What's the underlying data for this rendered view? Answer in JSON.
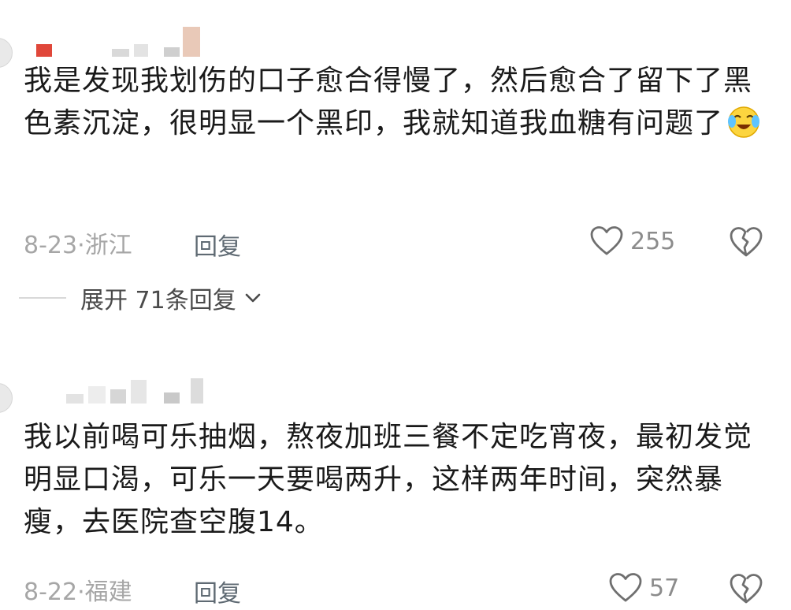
{
  "comments": [
    {
      "text": "我是发现我划伤的口子愈合得慢了，然后愈合了留下了黑色素沉淀，很明显一个黑印，我就知道我血糖有问题了",
      "emoji": "crying-laughing-emoji",
      "date": "8-23·浙江",
      "reply_label": "回复",
      "likes": "255"
    },
    {
      "text": "我以前喝可乐抽烟，熬夜加班三餐不定吃宵夜，最初发觉明显口渴，可乐一天要喝两升，这样两年时间，突然暴瘦，去医院查空腹14。",
      "date": "8-22·福建",
      "reply_label": "回复",
      "likes": "57"
    }
  ],
  "expand_replies": "展开 71条回复",
  "icons": [
    "heart-outline-icon",
    "broken-heart-icon",
    "chevron-down-icon"
  ],
  "colors": {
    "meta_gray": "#a6a6a6",
    "reply_gray": "#5f6a73",
    "text": "#1a1a1a"
  }
}
